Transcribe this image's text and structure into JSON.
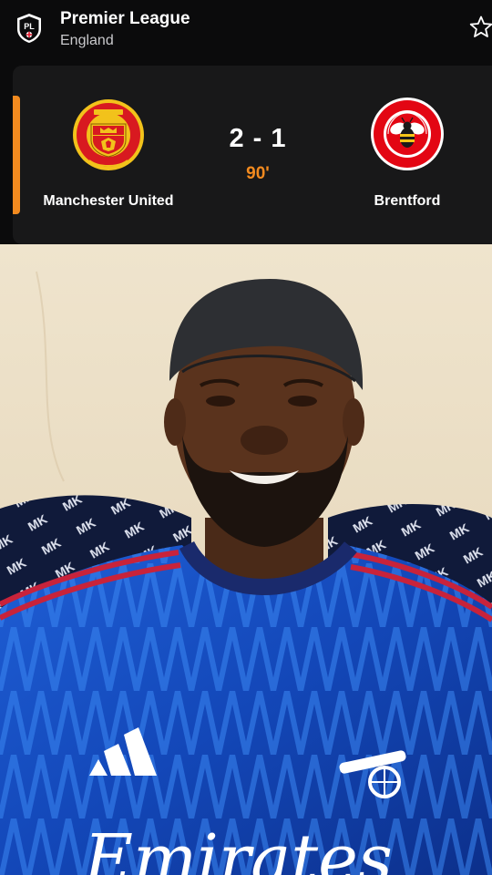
{
  "header": {
    "league_name": "Premier League",
    "country": "England",
    "league_logo_text": "PL"
  },
  "match": {
    "home_team": "Manchester United",
    "away_team": "Brentford",
    "score": "2 - 1",
    "minute": "90'",
    "home_goals": 2,
    "away_goals": 1,
    "status": "live"
  },
  "video": {
    "shirt_sponsor_text": "Emirates",
    "cushion_pattern_text": "MK"
  },
  "colors": {
    "accent": "#f28a1f",
    "background": "#0b0b0c",
    "card": "#181819",
    "text_primary": "#ffffff",
    "text_secondary": "#c9c9cc"
  },
  "icons": {
    "league_logo": "premier-league-logo",
    "favorite": "star-outline-icon",
    "home_crest": "manchester-united-crest",
    "away_crest": "brentford-crest"
  }
}
